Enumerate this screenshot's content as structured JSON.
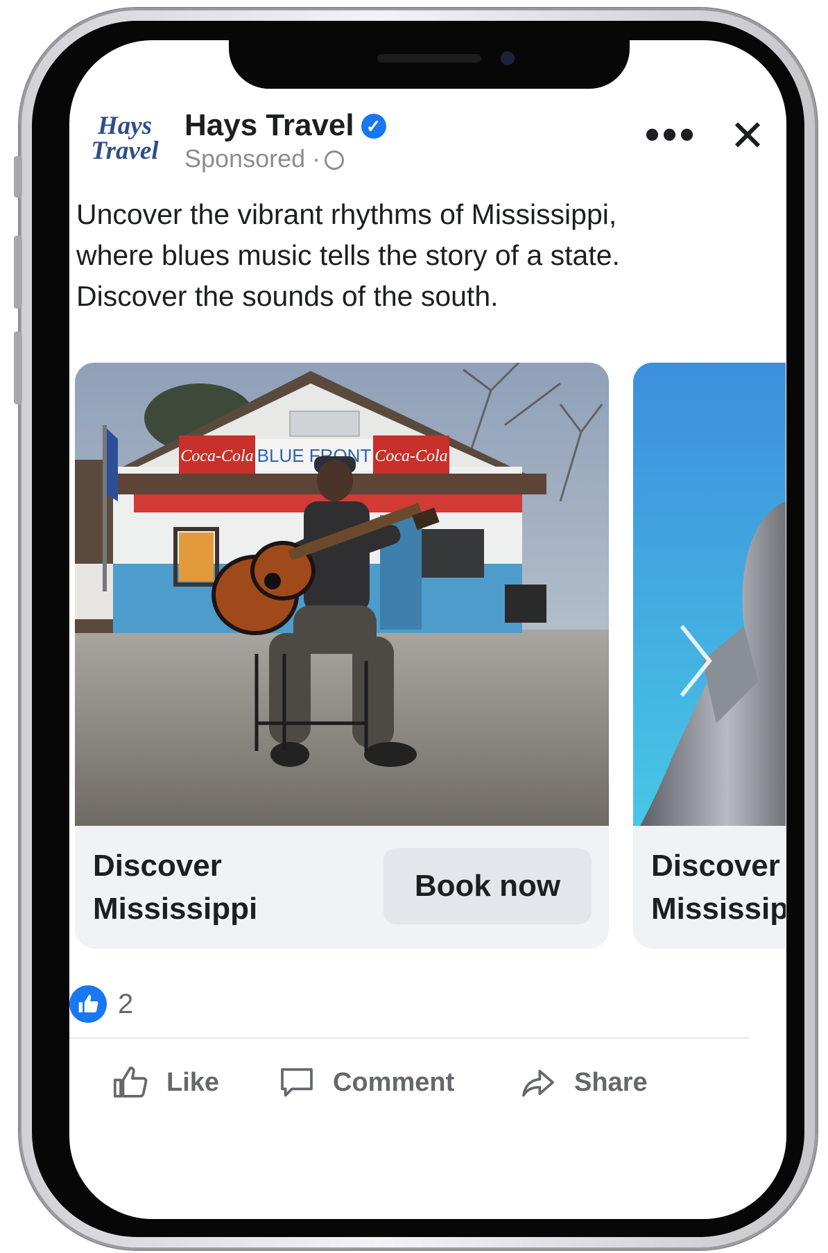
{
  "post": {
    "logo_text": "Hays Travel",
    "page_name": "Hays Travel",
    "meta": "Sponsored ·",
    "caption": "Uncover the vibrant rhythms of Mississippi, where blues music tells the story of a state. Discover the sounds of the south.",
    "more_label": "•••",
    "close_label": "✕"
  },
  "carousel": {
    "cards": [
      {
        "title_line1": "Discover",
        "title_line2": "Mississippi",
        "cta": "Book now",
        "sign_text": "BLUE FRONT",
        "brand_sign": "Coca-Cola"
      },
      {
        "title_line1": "Discover",
        "title_line2": "Mississippi"
      }
    ]
  },
  "reactions": {
    "count": "2"
  },
  "actions": {
    "like": "Like",
    "comment": "Comment",
    "share": "Share"
  },
  "colors": {
    "accent": "#1877f2",
    "text": "#1c1e21",
    "muted": "#65676b"
  }
}
